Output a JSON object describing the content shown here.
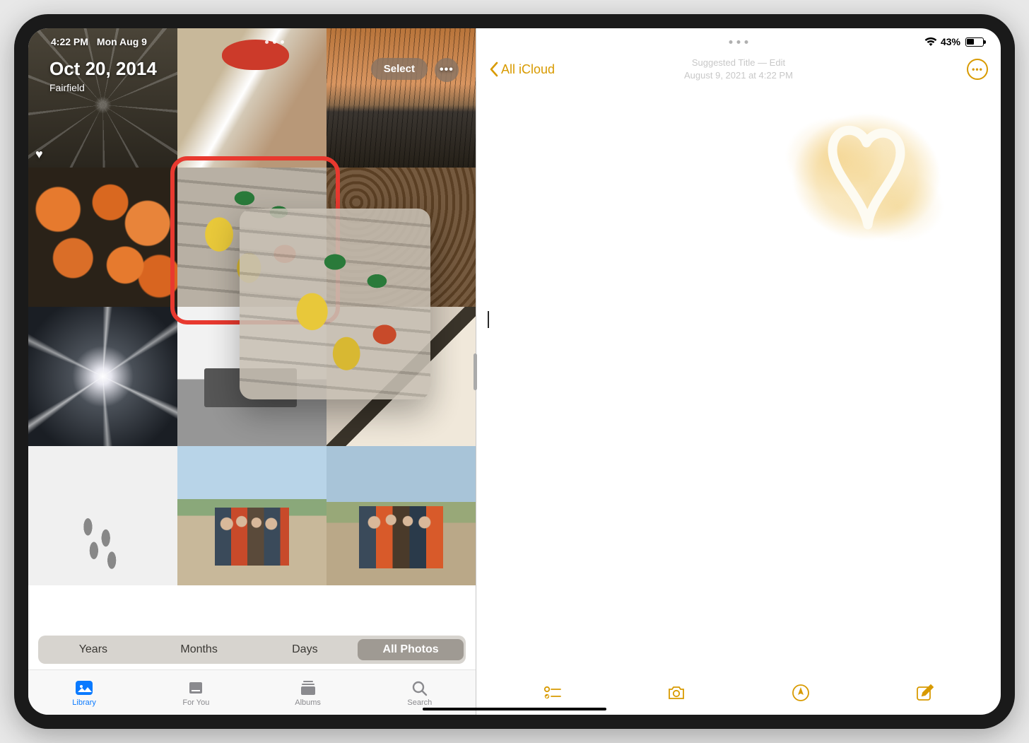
{
  "status_left": {
    "time": "4:22 PM",
    "date": "Mon Aug 9"
  },
  "status_right": {
    "battery_pct": "43%"
  },
  "photos": {
    "header": {
      "date_title": "Oct 20, 2014",
      "location": "Fairfield"
    },
    "actions": {
      "select_label": "Select"
    },
    "segmented": {
      "years": "Years",
      "months": "Months",
      "days": "Days",
      "all": "All Photos",
      "active": "all"
    },
    "tabs": {
      "library": "Library",
      "for_you": "For You",
      "albums": "Albums",
      "search": "Search",
      "active": "library"
    },
    "highlighted_thumbnail_index": 4
  },
  "notes": {
    "back_label": "All iCloud",
    "meta_line1": "Suggested Title — Edit",
    "meta_line2": "August 9, 2021 at 4:22 PM",
    "drawing": "yellow-watercolor-heart"
  }
}
